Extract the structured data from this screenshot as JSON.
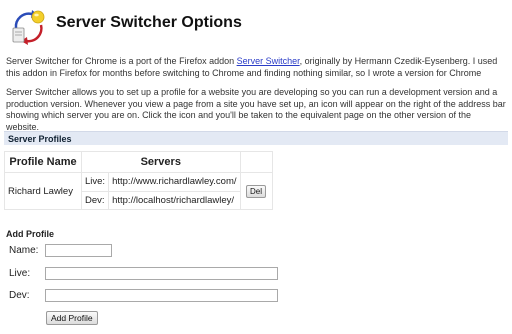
{
  "page": {
    "title": "Server Switcher Options"
  },
  "intro": {
    "part1": "Server Switcher for Chrome is a port of the Firefox addon ",
    "link": "Server Switcher",
    "part2": ", originally by Hermann Czedik-Eysenberg. I used this addon in Firefox for months before switching to Chrome and finding nothing similar, so I wrote a version for Chrome"
  },
  "description": "Server Switcher allows you to set up a profile for a website you are developing so you can run a development version and a production version. Whenever you view a page from a site you have set up, an icon will appear on the right of the address bar showing which server you are on. Click the icon and you'll be taken to the equivalent page on the other version of the website.",
  "profiles_section": {
    "heading": "Server Profiles",
    "col_profile": "Profile Name",
    "col_servers": "Servers",
    "rows": [
      {
        "name": "Richard Lawley",
        "live_label": "Live:",
        "live_url": "http://www.richardlawley.com/",
        "dev_label": "Dev:",
        "dev_url": "http://localhost/richardlawley/",
        "delete_label": "Del"
      }
    ]
  },
  "add_profile": {
    "heading": "Add Profile",
    "name_label": "Name:",
    "live_label": "Live:",
    "dev_label": "Dev:",
    "name_value": "",
    "live_value": "",
    "dev_value": "",
    "button_label": "Add Profile"
  }
}
